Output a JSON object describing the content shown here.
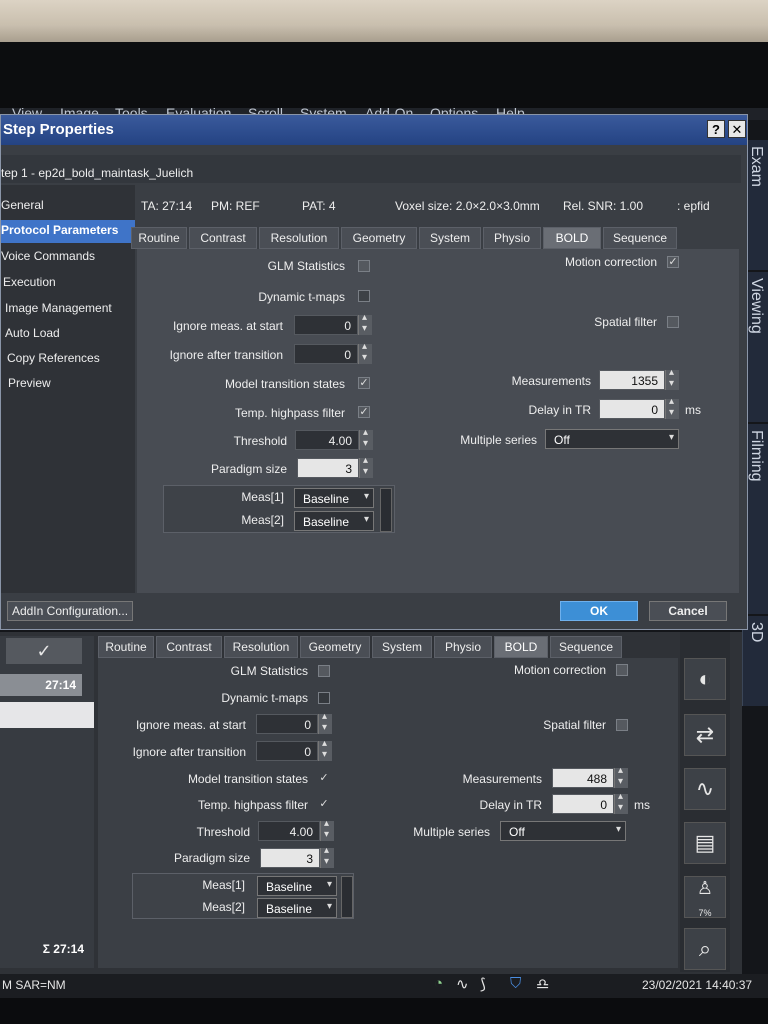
{
  "menu": [
    "View",
    "Image",
    "Tools",
    "Evaluation",
    "Scroll",
    "System",
    "Add-On",
    "Options",
    "Help"
  ],
  "side_tabs": [
    "Exam",
    "Viewing",
    "Filming",
    "3D"
  ],
  "dialog": {
    "title": "Step Properties",
    "help_btn": "?",
    "close_btn": "✕",
    "subtitle": "tep 1 - ep2d_bold_maintask_Juelich",
    "nav": [
      "General",
      "Protocol Parameters",
      "Voice Commands",
      "Execution",
      "Image Management",
      "Auto Load",
      "Copy References",
      "Preview"
    ],
    "info": {
      "ta": "TA: 27:14",
      "pm": "PM: REF",
      "pat": "PAT: 4",
      "voxel": "Voxel size: 2.0×2.0×3.0mm",
      "snr": "Rel. SNR: 1.00",
      "seq": ": epfid"
    },
    "tabs": [
      "Routine",
      "Contrast",
      "Resolution",
      "Geometry",
      "System",
      "Physio",
      "BOLD",
      "Sequence"
    ],
    "params": {
      "glm_label": "GLM Statistics",
      "dyn_label": "Dynamic t-maps",
      "ignore_start_label": "Ignore meas. at start",
      "ignore_start_value": "0",
      "ignore_trans_label": "Ignore after transition",
      "ignore_trans_value": "0",
      "model_label": "Model transition states",
      "highpass_label": "Temp. highpass filter",
      "threshold_label": "Threshold",
      "threshold_value": "4.00",
      "paradigm_label": "Paradigm size",
      "paradigm_value": "3",
      "meas1_label": "Meas[1]",
      "meas1_value": "Baseline",
      "meas2_label": "Meas[2]",
      "meas2_value": "Baseline",
      "motion_label": "Motion correction",
      "spatial_label": "Spatial filter",
      "measurements_label": "Measurements",
      "measurements_value": "1355",
      "delay_label": "Delay in TR",
      "delay_value": "0",
      "delay_unit": "ms",
      "multiple_label": "Multiple series",
      "multiple_value": "Off",
      "check_mark": "✓"
    },
    "addin_btn": "AddIn Configuration...",
    "ok_btn": "OK",
    "cancel_btn": "Cancel"
  },
  "lower": {
    "check_mark": "✓",
    "time_top": "27:14",
    "time_total": "Σ 27:14",
    "tabs": [
      "Routine",
      "Contrast",
      "Resolution",
      "Geometry",
      "System",
      "Physio",
      "BOLD",
      "Sequence"
    ],
    "params": {
      "glm_label": "GLM Statistics",
      "dyn_label": "Dynamic t-maps",
      "ignore_start_label": "Ignore meas. at start",
      "ignore_start_value": "0",
      "ignore_trans_label": "Ignore after transition",
      "ignore_trans_value": "0",
      "model_label": "Model transition states",
      "highpass_label": "Temp. highpass filter",
      "threshold_label": "Threshold",
      "threshold_value": "4.00",
      "paradigm_label": "Paradigm size",
      "paradigm_value": "3",
      "meas1_label": "Meas[1]",
      "meas1_value": "Baseline",
      "meas2_label": "Meas[2]",
      "meas2_value": "Baseline",
      "motion_label": "Motion correction",
      "spatial_label": "Spatial filter",
      "measurements_label": "Measurements",
      "measurements_value": "488",
      "delay_label": "Delay in TR",
      "delay_value": "0",
      "delay_unit": "ms",
      "multiple_label": "Multiple series",
      "multiple_value": "Off"
    },
    "tool_icons": [
      "inline-image-icon",
      "exchange-icon",
      "physio-icon",
      "layout-icon",
      "patient-position-icon",
      "search-icon"
    ],
    "sar_percent": "7%"
  },
  "status": {
    "sar": "M SAR=NM",
    "datetime": "23/02/2021 14:40:37"
  }
}
